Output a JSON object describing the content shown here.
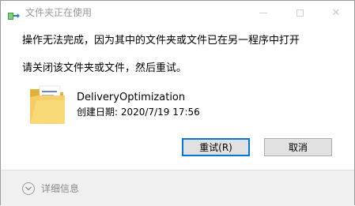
{
  "window": {
    "title": "文件夹正在使用",
    "controls": {
      "minimize": "minimize",
      "maximize": "maximize",
      "close": "✕"
    }
  },
  "dialog": {
    "message_line1": "操作无法完成，因为其中的文件夹或文件已在另一程序中打开",
    "message_line2": "请关闭该文件夹或文件，然后重试。",
    "item": {
      "icon": "folder-icon",
      "name": "DeliveryOptimization",
      "created": "创建日期: 2020/7/19 17:56"
    },
    "buttons": {
      "retry": "重试(R)",
      "cancel": "取消"
    },
    "details": {
      "icon": "chevron-down-icon",
      "label": "详细信息"
    }
  },
  "colors": {
    "accent": "#0078d7",
    "folder": "#f3c95a",
    "footer": "#f0f0f0"
  }
}
